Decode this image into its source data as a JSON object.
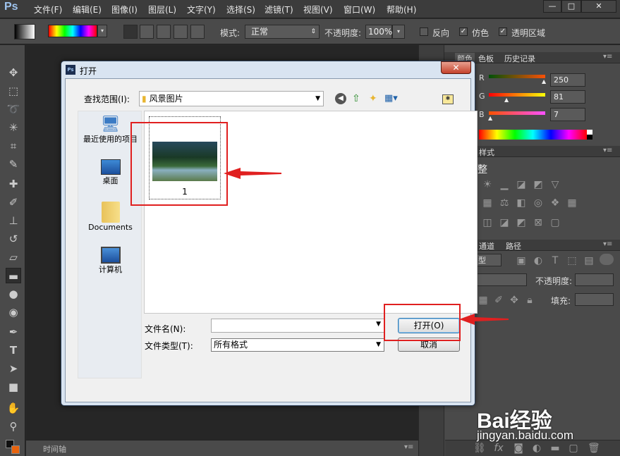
{
  "menubar": {
    "logo": "Ps",
    "items": [
      "文件(F)",
      "编辑(E)",
      "图像(I)",
      "图层(L)",
      "文字(Y)",
      "选择(S)",
      "滤镜(T)",
      "视图(V)",
      "窗口(W)",
      "帮助(H)"
    ],
    "window_controls": [
      "—",
      "□",
      "✕"
    ]
  },
  "options": {
    "mode_label": "模式:",
    "mode_value": "正常",
    "opacity_label": "不透明度:",
    "opacity_value": "100%",
    "reverse_label": "反向",
    "dither_label": "仿色",
    "transparency_label": "透明区域",
    "reverse_checked": false,
    "dither_checked": true,
    "transparency_checked": true
  },
  "panels": {
    "color_tabs": [
      "颜色",
      "色板",
      "历史记录"
    ],
    "channels": [
      {
        "name": "R",
        "value": "250"
      },
      {
        "name": "G",
        "value": "81"
      },
      {
        "name": "B",
        "value": "7"
      }
    ],
    "styles_tab": "样式",
    "adjust_label": "整",
    "layers_tabs": [
      "通道",
      "路径"
    ],
    "layer_kind": "型",
    "layer_opacity_label": "不透明度:",
    "fill_label": "填充:"
  },
  "timeline_label": "时间轴",
  "dialog": {
    "title_icon": "Ps",
    "title": "打开",
    "look_in_label": "查找范围(I):",
    "look_in_value": "风景图片",
    "places": [
      {
        "label": "最近使用的项目",
        "icon": "recent-icon"
      },
      {
        "label": "桌面",
        "icon": "desktop-icon"
      },
      {
        "label": "Documents",
        "icon": "folder-icon"
      },
      {
        "label": "计算机",
        "icon": "computer-icon"
      }
    ],
    "files": [
      {
        "name": "1"
      }
    ],
    "filename_label": "文件名(N):",
    "filename_value": "",
    "filetype_label": "文件类型(T):",
    "filetype_value": "所有格式",
    "open_button": "打开(O)",
    "cancel_button": "取消"
  },
  "watermark": {
    "brand": "Bai经验",
    "url": "jingyan.baidu.com"
  },
  "colors": {
    "annotation_red": "#e02020",
    "foreground": "#fa5107"
  }
}
